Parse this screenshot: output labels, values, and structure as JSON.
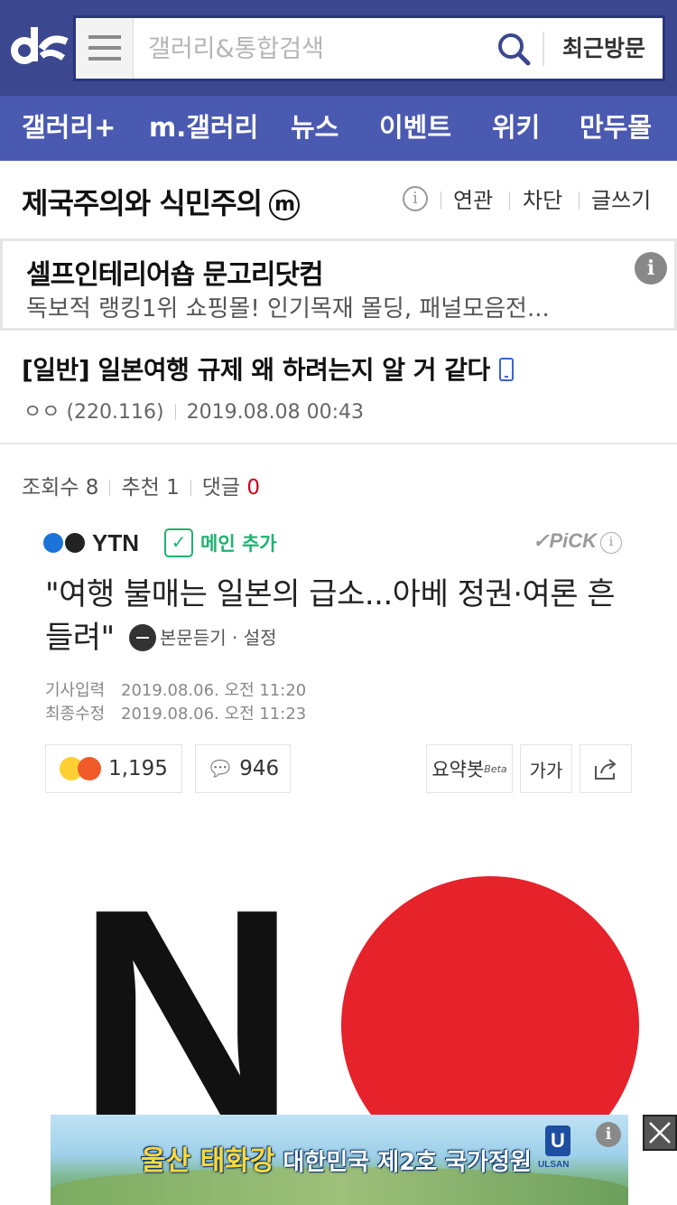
{
  "header": {
    "search_placeholder": "갤러리&통합검색",
    "recent_label": "최근방문",
    "colors": {
      "bar": "#3b4890",
      "nav": "#4a5ab0",
      "search_border": "#29367c"
    }
  },
  "nav": {
    "items": [
      {
        "label": "갤러리+"
      },
      {
        "label": "m.갤러리"
      },
      {
        "label": "뉴스"
      },
      {
        "label": "이벤트"
      },
      {
        "label": "위키"
      },
      {
        "label": "만두몰"
      }
    ]
  },
  "gallery": {
    "title": "제국주의와 식민주의",
    "badge": "m",
    "info_icon": "i",
    "actions": {
      "related": "연관",
      "block": "차단",
      "write": "글쓰기"
    }
  },
  "ad": {
    "title": "셀프인테리어숍 문고리닷컴",
    "desc": "독보적 랭킹1위 쇼핑몰! 인기목재 몰딩, 패널모음전...",
    "info_icon": "i"
  },
  "post": {
    "title": "[일반] 일본여행 규제 왜 하려는지 알 거 같다",
    "author": "ㅇㅇ (220.116)",
    "date": "2019.08.08 00:43",
    "views_label": "조회수",
    "views": "8",
    "recommend_label": "추천",
    "recommend": "1",
    "comments_label": "댓글",
    "comments": "0"
  },
  "article": {
    "source": "YTN",
    "main_add": "메인 추가",
    "pick": "PiCK",
    "pick_info": "i",
    "headline": "\"여행 불매는 일본의 급소...아베 정권·여론 흔들려\"",
    "listen": "본문듣기 · 설정",
    "input_label": "기사입력",
    "input_date": "2019.08.06. 오전 11:20",
    "modified_label": "최종수정",
    "modified_date": "2019.08.06. 오전 11:23",
    "reactions": "1,195",
    "comment_count": "946",
    "summary_bot": "요약봇",
    "beta": "Beta",
    "font_size": "가가",
    "image_text": "N"
  },
  "banner": {
    "highlight": "울산 태화강",
    "text": "대한민국 제2호 국가정원",
    "logo": "U",
    "logo_sub": "ULSAN",
    "info_icon": "i"
  }
}
